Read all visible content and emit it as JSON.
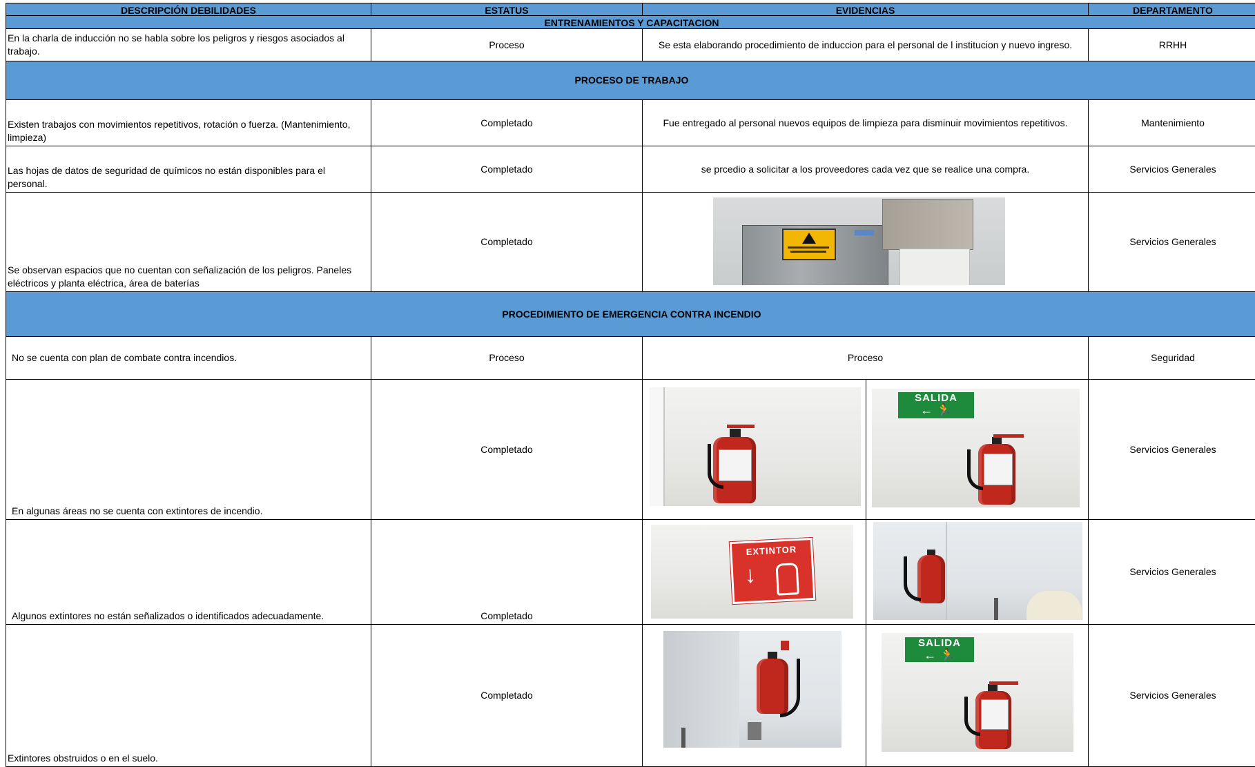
{
  "headers": {
    "col1": "DESCRIPCIÓN DEBILIDADES",
    "col2": "ESTATUS",
    "col3": "EVIDENCIAS",
    "col4": "DEPARTAMENTO"
  },
  "sections": {
    "s1": "ENTRENAMIENTOS Y CAPACITACION",
    "s2": "PROCESO DE TRABAJO",
    "s3": "PROCEDIMIENTO DE EMERGENCIA CONTRA INCENDIO"
  },
  "rows": [
    {
      "descripcion": "En la charla de inducción no se habla sobre los peligros y riesgos asociados al trabajo.",
      "estatus": "Proceso",
      "evidencia": "Se esta elaborando procedimiento de induccion para el personal de l institucion y nuevo ingreso.",
      "departamento": "RRHH"
    },
    {
      "descripcion": "Existen trabajos con movimientos repetitivos, rotación o fuerza. (Mantenimiento, limpieza)",
      "estatus": "Completado",
      "evidencia": "Fue entregado al personal nuevos equipos de limpieza para disminuir movimientos repetitivos.",
      "departamento": "Mantenimiento"
    },
    {
      "descripcion": "Las hojas de datos de seguridad de químicos no están disponibles para el personal.",
      "estatus": "Completado",
      "evidencia": "se prcedio a solicitar a los proveedores cada vez que se realice una compra.",
      "departamento": "Servicios Generales"
    },
    {
      "descripcion": "Se observan espacios que no cuentan con señalización de los peligros. Paneles eléctricos y planta eléctrica, área de baterías",
      "estatus": "Completado",
      "evidencia_photo": "electrical-panel-warning-sign-photo",
      "departamento": "Servicios Generales"
    },
    {
      "descripcion": "No se cuenta con plan de combate contra incendios.",
      "estatus": "Proceso",
      "evidencia": "Proceso",
      "departamento": "Seguridad"
    },
    {
      "descripcion": "En algunas áreas no se cuenta con extintores de incendio.",
      "estatus": "Completado",
      "evidencia_photos": [
        "fire-extinguisher-photo",
        "salida-sign-extinguisher-photo"
      ],
      "departamento": "Servicios Generales"
    },
    {
      "descripcion": "Algunos extintores no están señalizados o identificados adecuadamente.",
      "estatus": "Completado",
      "evidencia_photos": [
        "extintor-sign-photo",
        "extinguisher-corner-photo"
      ],
      "departamento": "Servicios Generales"
    },
    {
      "descripcion": "Extintores obstruidos o en el suelo.",
      "estatus": "Completado",
      "evidencia_photos": [
        "extinguisher-wall-photo",
        "salida-sign-extinguisher-photo"
      ],
      "departamento": "Servicios Generales"
    }
  ],
  "photo_text": {
    "salida": "SALIDA",
    "extintor": "EXTINTOR"
  },
  "colors": {
    "header_blue": "#5B9BD5",
    "sign_green": "#1e8a3c",
    "extinguisher_red": "#c0281e",
    "warning_yellow": "#f2b705"
  }
}
